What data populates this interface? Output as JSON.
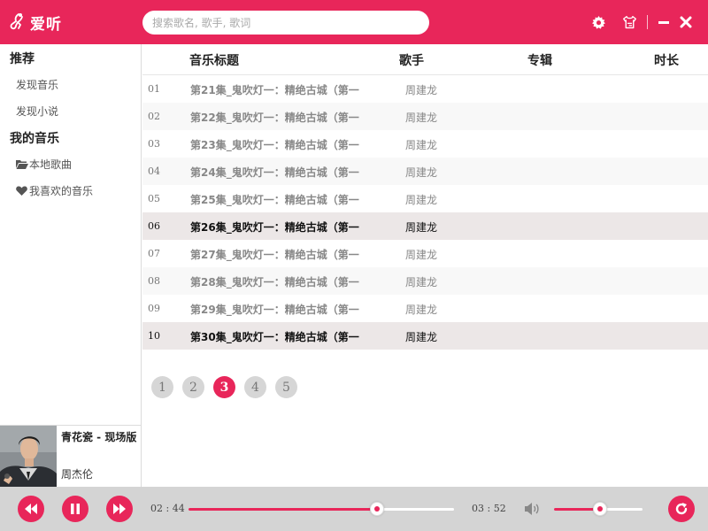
{
  "app": {
    "name": "爱听"
  },
  "search": {
    "placeholder": "搜索歌名, 歌手, 歌词"
  },
  "colors": {
    "accent": "#e8265a",
    "footer_bg": "#d4d4d4",
    "active_row": "#ece7e7"
  },
  "header_icons": [
    "gear-icon",
    "skin-icon",
    "minimize-icon",
    "close-icon"
  ],
  "sidebar": {
    "sections": [
      {
        "heading": "推荐",
        "items": [
          {
            "label": "发现音乐",
            "icon": ""
          },
          {
            "label": "发现小说",
            "icon": ""
          }
        ]
      },
      {
        "heading": "我的音乐",
        "items": [
          {
            "label": "本地歌曲",
            "icon": "folder-icon"
          },
          {
            "label": "我喜欢的音乐",
            "icon": "heart-icon"
          }
        ]
      }
    ]
  },
  "now_playing": {
    "title": "青花瓷 - 现场版",
    "artist": "周杰伦",
    "cover": "artist-cover-image"
  },
  "table": {
    "headers": {
      "title": "音乐标题",
      "artist": "歌手",
      "album": "专辑",
      "duration": "时长"
    },
    "rows": [
      {
        "num": "01",
        "title": "第21集_鬼吹灯一：精绝古城（第一",
        "artist": "周建龙",
        "album": "",
        "duration": ""
      },
      {
        "num": "02",
        "title": "第22集_鬼吹灯一：精绝古城（第一",
        "artist": "周建龙",
        "album": "",
        "duration": ""
      },
      {
        "num": "03",
        "title": "第23集_鬼吹灯一：精绝古城（第一",
        "artist": "周建龙",
        "album": "",
        "duration": ""
      },
      {
        "num": "04",
        "title": "第24集_鬼吹灯一：精绝古城（第一",
        "artist": "周建龙",
        "album": "",
        "duration": ""
      },
      {
        "num": "05",
        "title": "第25集_鬼吹灯一：精绝古城（第一",
        "artist": "周建龙",
        "album": "",
        "duration": ""
      },
      {
        "num": "06",
        "title": "第26集_鬼吹灯一：精绝古城（第一",
        "artist": "周建龙",
        "album": "",
        "duration": ""
      },
      {
        "num": "07",
        "title": "第27集_鬼吹灯一：精绝古城（第一",
        "artist": "周建龙",
        "album": "",
        "duration": ""
      },
      {
        "num": "08",
        "title": "第28集_鬼吹灯一：精绝古城（第一",
        "artist": "周建龙",
        "album": "",
        "duration": ""
      },
      {
        "num": "09",
        "title": "第29集_鬼吹灯一：精绝古城（第一",
        "artist": "周建龙",
        "album": "",
        "duration": ""
      },
      {
        "num": "10",
        "title": "第30集_鬼吹灯一：精绝古城（第一",
        "artist": "周建龙",
        "album": "",
        "duration": ""
      }
    ],
    "active_rows": [
      "06",
      "10"
    ]
  },
  "pagination": {
    "pages": [
      "1",
      "2",
      "3",
      "4",
      "5"
    ],
    "current": "3"
  },
  "player": {
    "controls": [
      "previous-icon",
      "pause-icon",
      "next-icon",
      "volume-icon",
      "repeat-icon"
    ],
    "elapsed": "02 : 44",
    "total": "03 : 52",
    "progress": 0.71,
    "volume": 0.52
  }
}
